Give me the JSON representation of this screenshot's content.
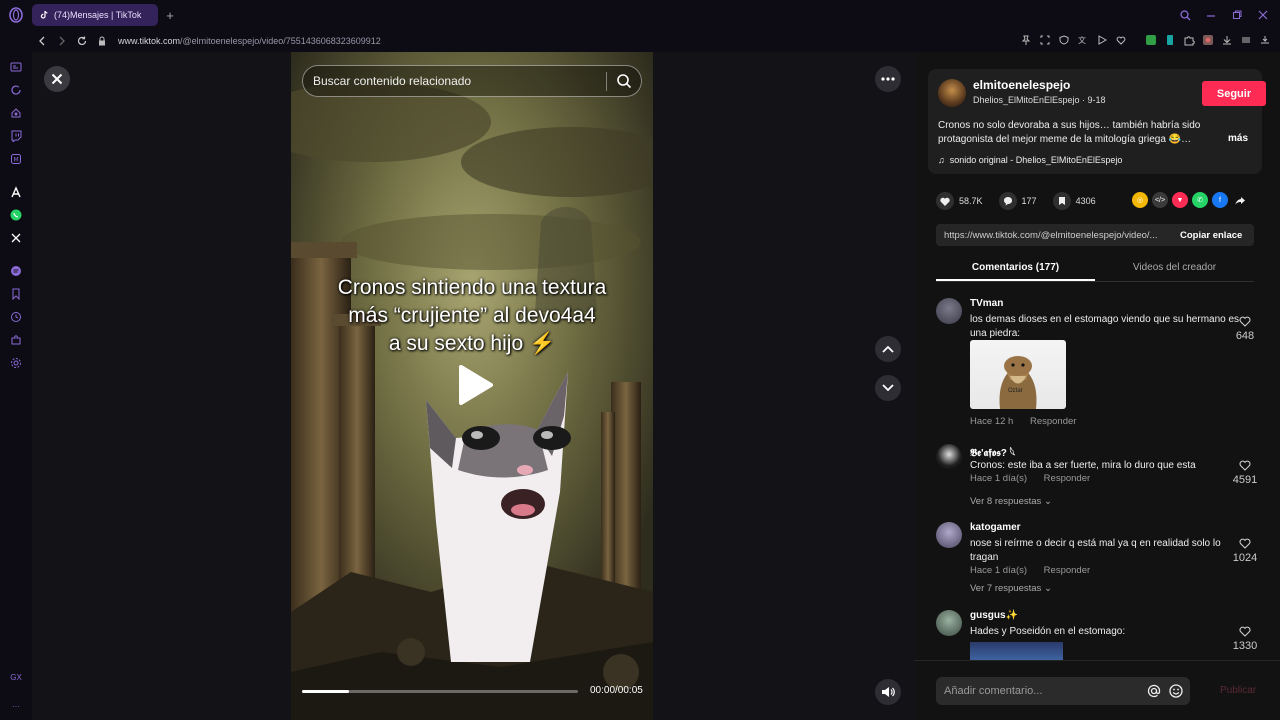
{
  "browser": {
    "tab_title": "(74)Mensajes | TikTok",
    "url_host": "www.tiktok.com",
    "url_path": "/@elmitoenelespejo/video/7551436068323609912"
  },
  "sidebar_bottom_label": "GX",
  "video": {
    "search_placeholder": "Buscar contenido relacionado",
    "caption_line1": "Cronos sintiendo una textura",
    "caption_line2": "más “crujiente” al devo4a4",
    "caption_line3": "a su sexto hijo ⚡",
    "timecode": "00:00/00:05",
    "progress": 0.17
  },
  "author": {
    "username": "elmitoenelespejo",
    "nickname_date": "Dhelios_ElMitoEnElEspejo · 9-18",
    "follow_label": "Seguir",
    "description": "Cronos no solo devoraba a sus hijos… también habría sido protagonista del mejor meme de la mitología griega 😂…",
    "more_label": "más",
    "sound": "sonido original - Dhelios_ElMitoEnElEspejo"
  },
  "stats": {
    "likes": "58.7K",
    "comments": "177",
    "saves": "4306"
  },
  "share_link": {
    "url": "https://www.tiktok.com/@elmitoenelespejo/video/...",
    "copy_label": "Copiar enlace"
  },
  "tabs": {
    "comments": "Comentarios (177)",
    "creator_videos": "Videos del creador"
  },
  "comments": [
    {
      "name": "TVman",
      "text": "los demas dioses en el estomago viendo que su hermano es una piedra:",
      "sticker_text": "Oztar",
      "time": "Hace 12 h",
      "reply": "Responder",
      "likes": "648"
    },
    {
      "name": "𝕭𝖊'𝖆𝖋𝖔𝖘? 𓆩",
      "text": "Cronos: este iba a ser fuerte, mira lo duro que esta",
      "time": "Hace 1 día(s)",
      "reply": "Responder",
      "likes": "4591",
      "replies": "Ver 8 respuestas"
    },
    {
      "name": "katogamer",
      "text": "nose si reírme o decir q está mal ya q en realidad solo lo tragan",
      "time": "Hace 1 día(s)",
      "reply": "Responder",
      "likes": "1024",
      "replies": "Ver 7 respuestas"
    },
    {
      "name": "gusgus✨",
      "text": "Hades y Poseidón en el estomago:",
      "likes": "1330"
    }
  ],
  "footer": {
    "placeholder": "Añadir comentario...",
    "publish_label": "Publicar"
  },
  "colors": {
    "accent": "#fe2c55",
    "tab_bg": "#34225a",
    "panel_bg": "#121212"
  }
}
